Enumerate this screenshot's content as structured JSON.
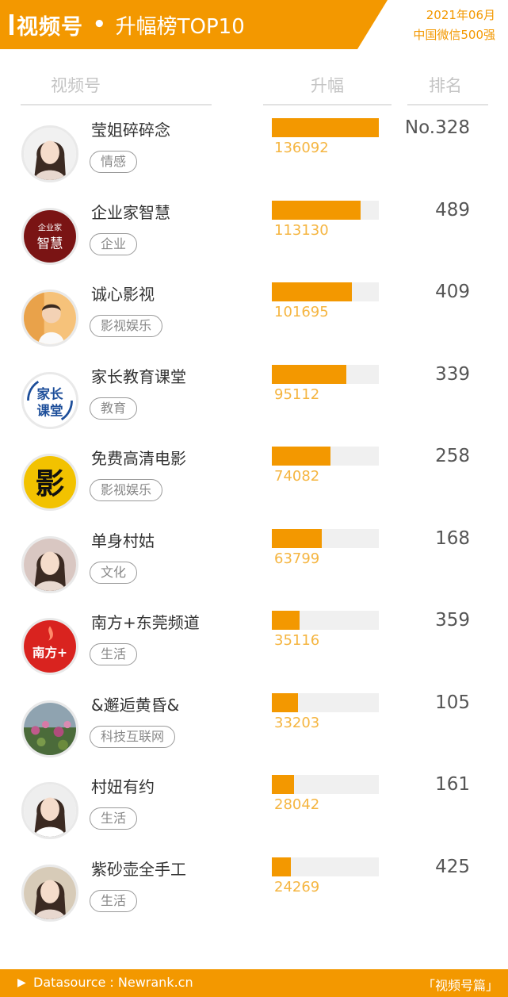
{
  "header": {
    "title_main": "视频号",
    "title_dot": "•",
    "title_sub": "升幅榜TOP10",
    "date_line1": "2021年06月",
    "date_line2": "中国微信500强"
  },
  "columns": {
    "name": "视频号",
    "rise": "升幅",
    "rank": "排名"
  },
  "bar_max": 136092,
  "rows": [
    {
      "name": "莹姐碎碎念",
      "tag": "情感",
      "value": 136092,
      "value_label": "136092",
      "rank": "No.328",
      "avatar_icon": "portrait-woman-icon"
    },
    {
      "name": "企业家智慧",
      "tag": "企业",
      "value": 113130,
      "value_label": "113130",
      "rank": "489",
      "avatar_icon": "calligraphy-logo-icon",
      "avatar_text_top": "企业家",
      "avatar_text_bottom": "智慧"
    },
    {
      "name": "诚心影视",
      "tag": "影视娱乐",
      "value": 101695,
      "value_label": "101695",
      "rank": "409",
      "avatar_icon": "portrait-child-icon"
    },
    {
      "name": "家长教育课堂",
      "tag": "教育",
      "value": 95112,
      "value_label": "95112",
      "rank": "339",
      "avatar_icon": "text-logo-icon",
      "avatar_text_top": "家长",
      "avatar_text_bottom": "课堂"
    },
    {
      "name": "免费高清电影",
      "tag": "影视娱乐",
      "value": 74082,
      "value_label": "74082",
      "rank": "258",
      "avatar_icon": "film-logo-icon",
      "avatar_text_top": "影"
    },
    {
      "name": "单身村姑",
      "tag": "文化",
      "value": 63799,
      "value_label": "63799",
      "rank": "168",
      "avatar_icon": "portrait-woman-icon"
    },
    {
      "name": "南方+东莞频道",
      "tag": "生活",
      "value": 35116,
      "value_label": "35116",
      "rank": "359",
      "avatar_icon": "news-logo-icon",
      "avatar_text_top": "南方+"
    },
    {
      "name": "&邂逅黄昏&",
      "tag": "科技互联网",
      "value": 33203,
      "value_label": "33203",
      "rank": "105",
      "avatar_icon": "flowers-photo-icon"
    },
    {
      "name": "村妞有约",
      "tag": "生活",
      "value": 28042,
      "value_label": "28042",
      "rank": "161",
      "avatar_icon": "portrait-woman-icon"
    },
    {
      "name": "紫砂壶全手工",
      "tag": "生活",
      "value": 24269,
      "value_label": "24269",
      "rank": "425",
      "avatar_icon": "portrait-woman-icon"
    }
  ],
  "footer": {
    "source": "Datasource : Newrank.cn",
    "series": "「视频号篇」"
  },
  "colors": {
    "accent": "#f39800",
    "value_text": "#f5b540",
    "bar_track": "#f0f0f0"
  }
}
